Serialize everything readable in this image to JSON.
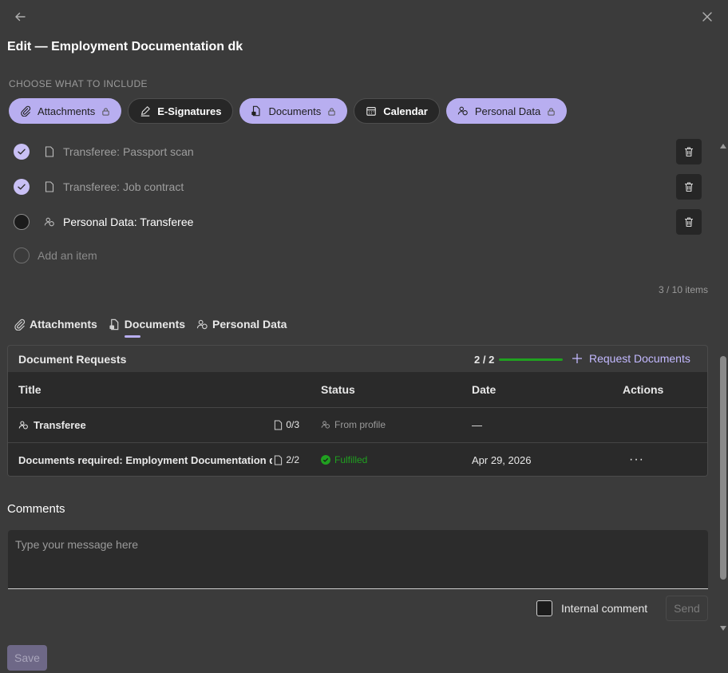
{
  "header": {
    "title": "Edit — Employment Documentation dk"
  },
  "include": {
    "label": "CHOOSE WHAT TO INCLUDE",
    "chips": [
      {
        "label": "Attachments",
        "state": "selected",
        "icon": "paperclip-icon"
      },
      {
        "label": "E-Signatures",
        "state": "unselected",
        "icon": "pen-icon"
      },
      {
        "label": "Documents",
        "state": "selected",
        "icon": "document-lock-icon"
      },
      {
        "label": "Calendar",
        "state": "unselected",
        "icon": "calendar-icon"
      },
      {
        "label": "Personal Data",
        "state": "selected",
        "icon": "people-icon"
      }
    ]
  },
  "checklist": {
    "items": [
      {
        "label": "Transferee: Passport scan",
        "done": true,
        "icon": "document-icon"
      },
      {
        "label": "Transferee: Job contract",
        "done": true,
        "icon": "document-icon"
      },
      {
        "label": "Personal Data: Transferee",
        "done": false,
        "icon": "people-icon"
      }
    ],
    "add_placeholder": "Add an item",
    "count": "3 / 10 items"
  },
  "tabs": [
    {
      "label": "Attachments",
      "icon": "paperclip-icon"
    },
    {
      "label": "Documents",
      "icon": "document-lock-icon",
      "active": true
    },
    {
      "label": "Personal Data",
      "icon": "people-icon"
    }
  ],
  "requests": {
    "title": "Document Requests",
    "progress_text": "2 / 2",
    "progress_fraction": 1.0,
    "request_button": "Request Documents",
    "columns": [
      "Title",
      "Status",
      "Date",
      "Actions"
    ],
    "rows": [
      {
        "title": "Transferee",
        "count": "0/3",
        "status": "From profile",
        "date": "—",
        "actions": ""
      },
      {
        "title": "Documents required: Employment Documentation dk",
        "count": "2/2",
        "status": "Fulfilled",
        "date": "Apr 29, 2026",
        "actions": "···"
      }
    ]
  },
  "comments": {
    "title": "Comments",
    "placeholder": "Type your message here",
    "internal_label": "Internal comment",
    "send_label": "Send"
  },
  "footer": {
    "save_label": "Save"
  },
  "colors": {
    "accent": "#b8aef0",
    "success": "#20a020",
    "background": "#3b3b3b"
  }
}
